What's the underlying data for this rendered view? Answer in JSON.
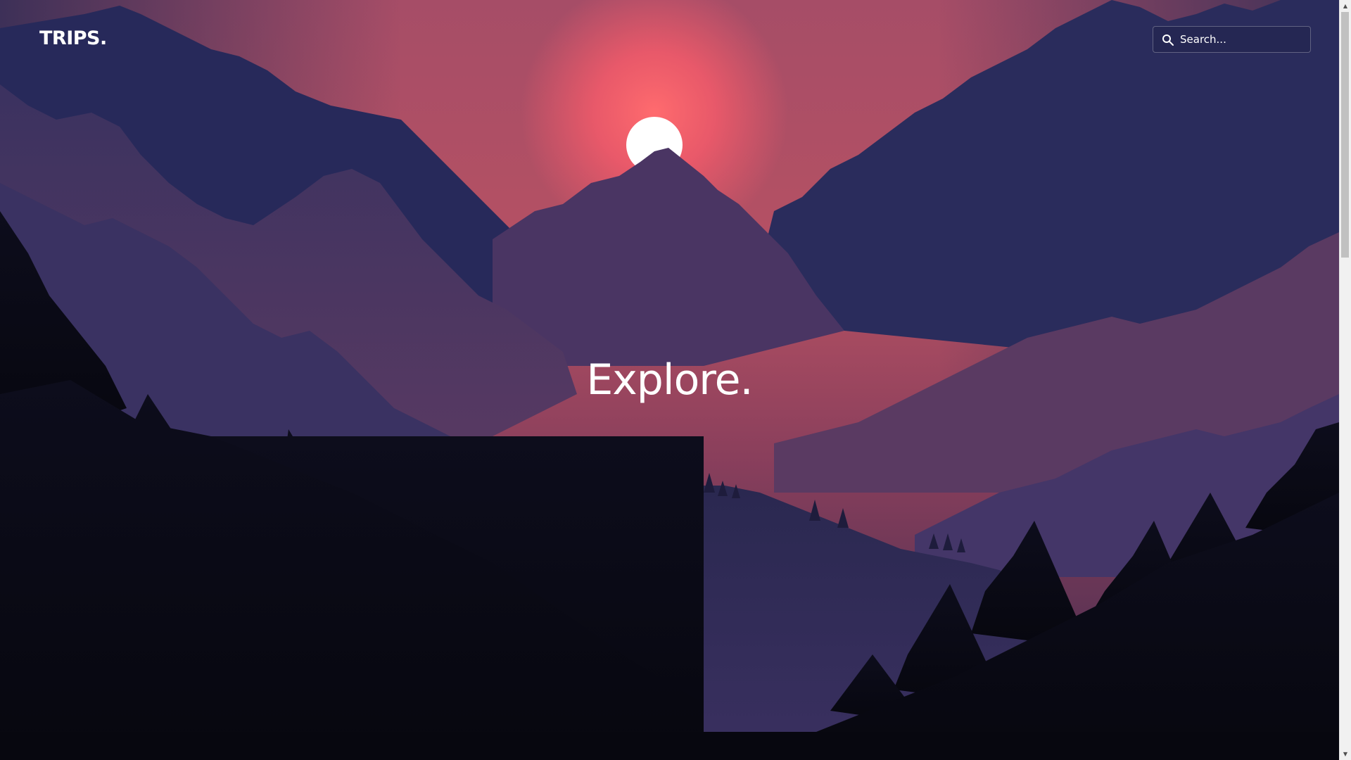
{
  "header": {
    "logo_text": "TRIPS."
  },
  "search": {
    "placeholder": "Search...",
    "icon": "search-icon"
  },
  "hero": {
    "title": "Explore."
  },
  "scrollbar": {
    "up_arrow": "▲",
    "down_arrow": "▼"
  },
  "colors": {
    "sky_top": "#a44b66",
    "sun_glow": "#ef5a6a",
    "sun": "#ffffff",
    "text": "#ffffff"
  }
}
